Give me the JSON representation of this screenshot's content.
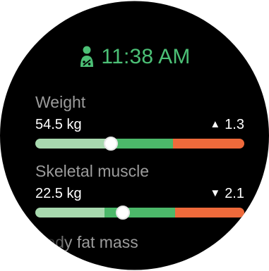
{
  "header": {
    "time": "11:38 AM",
    "icon": "person-body-composition-icon",
    "accent_color": "#4CC076"
  },
  "metrics": [
    {
      "label": "Weight",
      "value": "54.5 kg",
      "delta_direction": "up",
      "delta_arrow": "▲",
      "delta": "1.3",
      "scale": {
        "segments": [
          {
            "name": "low",
            "color": "#A8D9AF",
            "fraction": 0.36
          },
          {
            "name": "normal",
            "color": "#4CB86A",
            "fraction": 0.3
          },
          {
            "name": "high",
            "color": "#EF6A3B",
            "fraction": 0.34
          }
        ],
        "indicator_fraction": 0.36
      }
    },
    {
      "label": "Skeletal muscle",
      "value": "22.5 kg",
      "delta_direction": "down",
      "delta_arrow": "▼",
      "delta": "2.1",
      "scale": {
        "segments": [
          {
            "name": "low",
            "color": "#A8D9AF",
            "fraction": 0.33
          },
          {
            "name": "normal",
            "color": "#4CB86A",
            "fraction": 0.34
          },
          {
            "name": "high",
            "color": "#EF6A3B",
            "fraction": 0.33
          }
        ],
        "indicator_fraction": 0.42
      }
    }
  ],
  "next_metric": {
    "label": "Body fat mass"
  }
}
